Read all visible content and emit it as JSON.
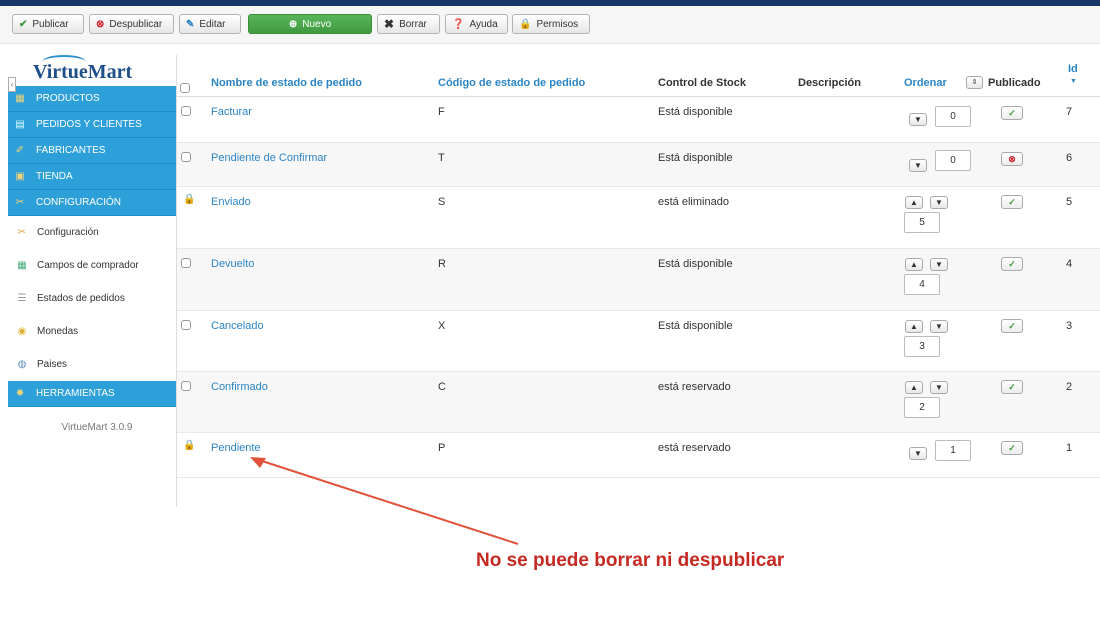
{
  "toolbar": {
    "publish": "Publicar",
    "unpublish": "Despublicar",
    "edit": "Editar",
    "new": "Nuevo",
    "delete": "Borrar",
    "help": "Ayuda",
    "permissions": "Permisos"
  },
  "sidebar": {
    "logo": "VirtueMart",
    "sections": [
      {
        "label": "PRODUCTOS"
      },
      {
        "label": "PEDIDOS Y CLIENTES"
      },
      {
        "label": "FABRICANTES"
      },
      {
        "label": "TIENDA"
      },
      {
        "label": "CONFIGURACIÓN"
      }
    ],
    "sub_items": [
      {
        "label": "Configuración"
      },
      {
        "label": "Campos de comprador"
      },
      {
        "label": "Estados de pedidos"
      },
      {
        "label": "Monedas"
      },
      {
        "label": "Paises"
      }
    ],
    "tools": "HERRAMIENTAS",
    "version": "VirtueMart 3.0.9"
  },
  "table": {
    "headers": {
      "name": "Nombre de estado de pedido",
      "code": "Código de estado de pedido",
      "stock": "Control de Stock",
      "description": "Descripción",
      "order": "Ordenar",
      "published": "Publicado",
      "id": "Id"
    },
    "rows": [
      {
        "name": "Facturar",
        "code": "F",
        "stock": "Está disponible",
        "order": "0",
        "published": true,
        "id": "7",
        "locked": false
      },
      {
        "name": "Pendiente de Confirmar",
        "code": "T",
        "stock": "Está disponible",
        "order": "0",
        "published": false,
        "id": "6",
        "locked": false
      },
      {
        "name": "Enviado",
        "code": "S",
        "stock": "está eliminado",
        "order": "5",
        "published": true,
        "id": "5",
        "locked": true
      },
      {
        "name": "Devuelto",
        "code": "R",
        "stock": "Está disponible",
        "order": "4",
        "published": true,
        "id": "4",
        "locked": false
      },
      {
        "name": "Cancelado",
        "code": "X",
        "stock": "Está disponible",
        "order": "3",
        "published": true,
        "id": "3",
        "locked": false
      },
      {
        "name": "Confirmado",
        "code": "C",
        "stock": "está reservado",
        "order": "2",
        "published": true,
        "id": "2",
        "locked": false
      },
      {
        "name": "Pendiente",
        "code": "P",
        "stock": "está reservado",
        "order": "1",
        "published": true,
        "id": "1",
        "locked": true
      }
    ]
  },
  "annotation": "No se puede borrar ni despublicar",
  "colors": {
    "accent": "#2ea0d9",
    "link": "#2c85c5",
    "annotation": "#c42a22",
    "new_button": "#4aa84b",
    "topbar": "#1a3867"
  }
}
